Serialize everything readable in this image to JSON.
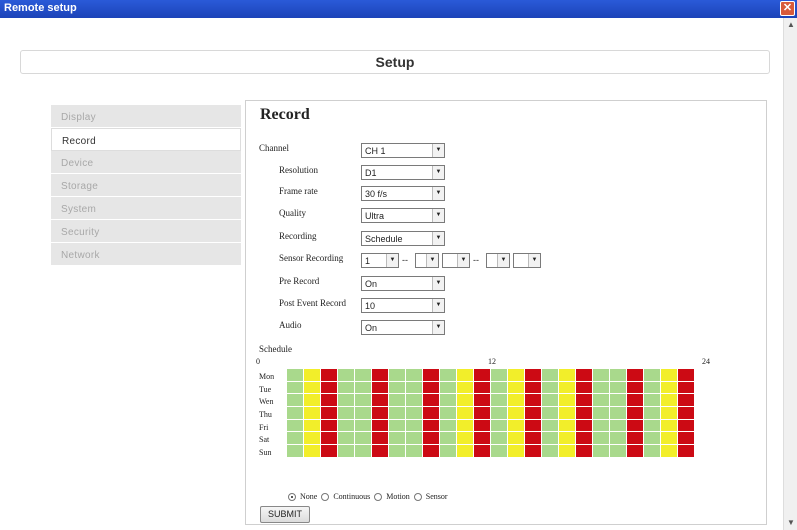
{
  "window": {
    "title": "Remote setup",
    "close_glyph": "✕"
  },
  "setup_header": "Setup",
  "menu": [
    "Display",
    "Record",
    "Device",
    "Storage",
    "System",
    "Security",
    "Network"
  ],
  "active_menu": "Record",
  "section_title": "Record",
  "fields": [
    {
      "label": "Channel",
      "value": "CH 1"
    },
    {
      "label": "Resolution",
      "value": "D1"
    },
    {
      "label": "Frame rate",
      "value": "30 f/s"
    },
    {
      "label": "Quality",
      "value": "Ultra"
    },
    {
      "label": "Recording",
      "value": "Schedule"
    },
    {
      "label": "Sensor Recording",
      "values": [
        "1",
        "",
        "",
        "",
        ""
      ],
      "separator": "--"
    },
    {
      "label": "Pre Record",
      "value": "On"
    },
    {
      "label": "Post Event Record",
      "value": "10"
    },
    {
      "label": "Audio",
      "value": "On"
    }
  ],
  "schedule": {
    "label": "Schedule",
    "hours": [
      "0",
      "12",
      "24"
    ],
    "days": [
      "Mon",
      "Tue",
      "Wen",
      "Thu",
      "Fri",
      "Sat",
      "Sun"
    ],
    "pattern": [
      "green",
      "yellow",
      "red",
      "green",
      "green",
      "red",
      "green",
      "green",
      "red",
      "green",
      "yellow",
      "red",
      "green",
      "yellow",
      "red",
      "green",
      "yellow",
      "red",
      "green",
      "green",
      "red",
      "green",
      "yellow",
      "red"
    ],
    "colors": {
      "green": "#a9d98c",
      "yellow": "#f2ee2a",
      "red": "#cc0a14"
    }
  },
  "modes": [
    {
      "label": "None",
      "selected": true
    },
    {
      "label": "Continuous",
      "selected": false
    },
    {
      "label": "Motion",
      "selected": false
    },
    {
      "label": "Sensor",
      "selected": false
    }
  ],
  "submit_label": "SUBMIT",
  "icons": {
    "dropdown": "chevron-down-icon",
    "scroll_up": "arrow-up-icon",
    "scroll_down": "arrow-down-icon"
  }
}
